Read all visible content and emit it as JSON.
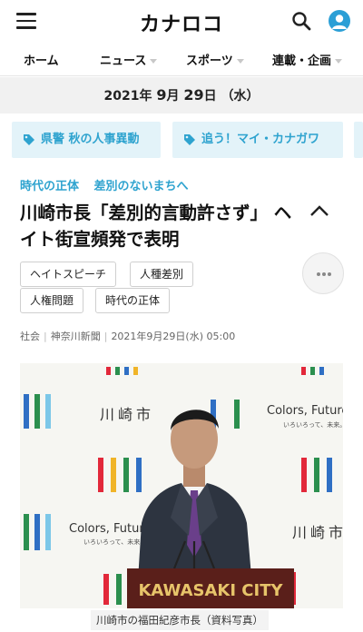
{
  "header": {
    "logo": "カナロコ",
    "menu_icon": "hamburger-menu-icon",
    "search_icon": "search-icon",
    "account_icon": "user-account-icon"
  },
  "nav": {
    "items": [
      {
        "label": "ホーム"
      },
      {
        "label": "ニュース"
      },
      {
        "label": "スポーツ"
      },
      {
        "label": "連載・企画"
      }
    ]
  },
  "date": {
    "year": "2021年",
    "month": "9",
    "month_suffix": "月",
    "day": "29",
    "day_suffix": "日",
    "weekday": "（水）"
  },
  "topic_tags": [
    {
      "label": "県警 秋の人事異動"
    },
    {
      "label": "追う！マイ・カナガワ"
    }
  ],
  "article": {
    "series": [
      "時代の正体",
      "差別のないまちへ"
    ],
    "headline": "川崎市長「差別的言動許さず」 ヘイト街宣頻発で表明",
    "keywords": [
      "ヘイトスピーチ",
      "人種差別",
      "人権問題",
      "時代の正体"
    ],
    "category": "社会",
    "source": "神奈川新聞",
    "published": "2021年9月29日(水) 05:00",
    "photo_caption": "川崎市の福田紀彦市長（資料写真）"
  },
  "photo_backdrop": {
    "city_kanji": "川崎市",
    "slogan_en": "Colors, Future!",
    "slogan_jp": "いろいろって、未来。",
    "podium": "KAWASAKI CITY"
  },
  "colors": {
    "accent": "#2ea3cf",
    "tag_bg": "#e3f3f9",
    "date_bg": "#f1f1f1",
    "avatar": "#2b9fd6"
  }
}
